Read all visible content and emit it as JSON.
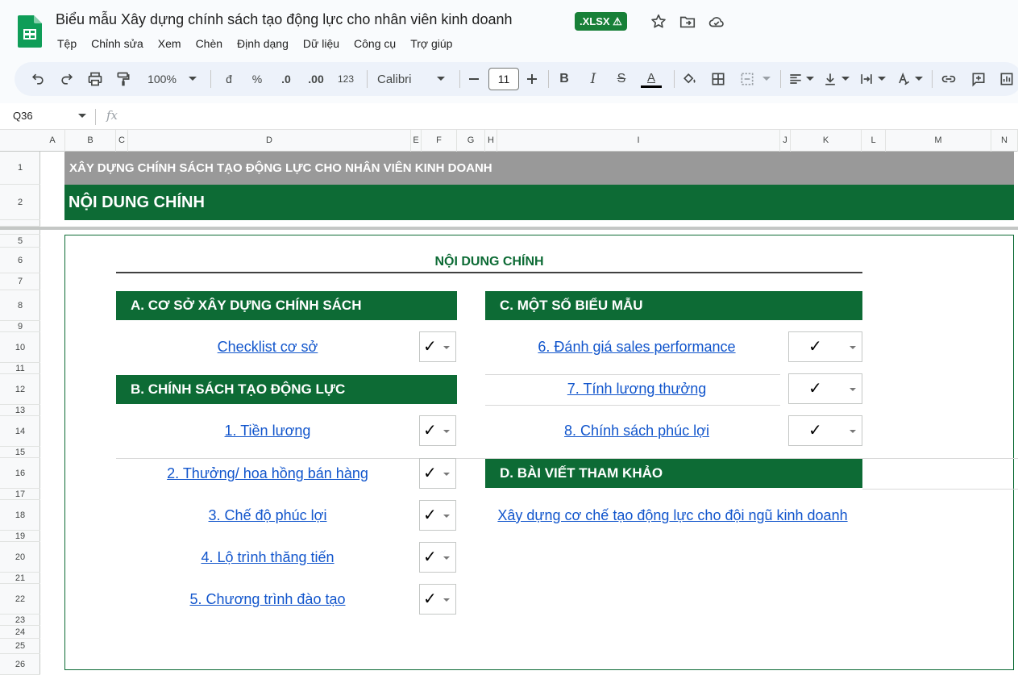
{
  "app": {
    "doc_title": "Biểu mẫu Xây dựng chính sách tạo động lực cho nhân viên kinh doanh",
    "format_badge": ".XLSX ⚠",
    "menu": [
      "Tệp",
      "Chỉnh sửa",
      "Xem",
      "Chèn",
      "Định dạng",
      "Dữ liệu",
      "Công cụ",
      "Trợ giúp"
    ]
  },
  "toolbar": {
    "zoom": "100%",
    "currency": "đ",
    "percent": "%",
    "dec_decrease": ".0",
    "dec_increase": ".00",
    "number_format": "123",
    "font": "Calibri",
    "font_size": "11",
    "bold": "B",
    "italic": "I",
    "strike": "S",
    "text_color": "A"
  },
  "formula_bar": {
    "cell_ref": "Q36",
    "fx": "fx"
  },
  "grid": {
    "columns": [
      "A",
      "B",
      "C",
      "D",
      "E",
      "F",
      "G",
      "H",
      "I",
      "J",
      "K",
      "L",
      "M",
      "N"
    ],
    "rows": [
      "1",
      "2",
      "5",
      "6",
      "7",
      "8",
      "9",
      "10",
      "11",
      "12",
      "13",
      "14",
      "15",
      "16",
      "17",
      "18",
      "19",
      "20",
      "21",
      "22",
      "23",
      "24",
      "25",
      "26"
    ]
  },
  "sheet": {
    "header_gray": "XÂY DỰNG CHÍNH SÁCH TẠO ĐỘNG LỰC CHO NHÂN VIÊN KINH DOANH",
    "header_green": "NỘI DUNG CHÍNH",
    "box_title": "NỘI DUNG CHÍNH",
    "section_a": {
      "title": "A. CƠ SỞ XÂY DỰNG CHÍNH SÁCH",
      "items": [
        {
          "label": "Checklist cơ sở",
          "check": "✓"
        }
      ]
    },
    "section_b": {
      "title": "B. CHÍNH SÁCH TẠO ĐỘNG LỰC",
      "items": [
        {
          "label": "1. Tiền lương",
          "check": "✓"
        },
        {
          "label": "2. Thưởng/ hoa hồng bán hàng",
          "check": "✓"
        },
        {
          "label": "3. Chế độ phúc lợi",
          "check": "✓"
        },
        {
          "label": "4. Lộ trình thăng tiến",
          "check": "✓"
        },
        {
          "label": "5. Chương trình đào tạo",
          "check": "✓"
        }
      ]
    },
    "section_c": {
      "title": "C. MỘT SỐ BIỂU MẪU",
      "items": [
        {
          "label": "6. Đánh giá sales performance",
          "check": "✓"
        },
        {
          "label": "7. Tính lương thưởng",
          "check": "✓"
        },
        {
          "label": "8. Chính sách phúc lợi",
          "check": "✓"
        }
      ]
    },
    "section_d": {
      "title": "D. BÀI VIẾT THAM KHẢO",
      "items": [
        {
          "label": "Xây dựng cơ chế tạo động lực cho đội ngũ kinh doanh"
        }
      ]
    }
  }
}
